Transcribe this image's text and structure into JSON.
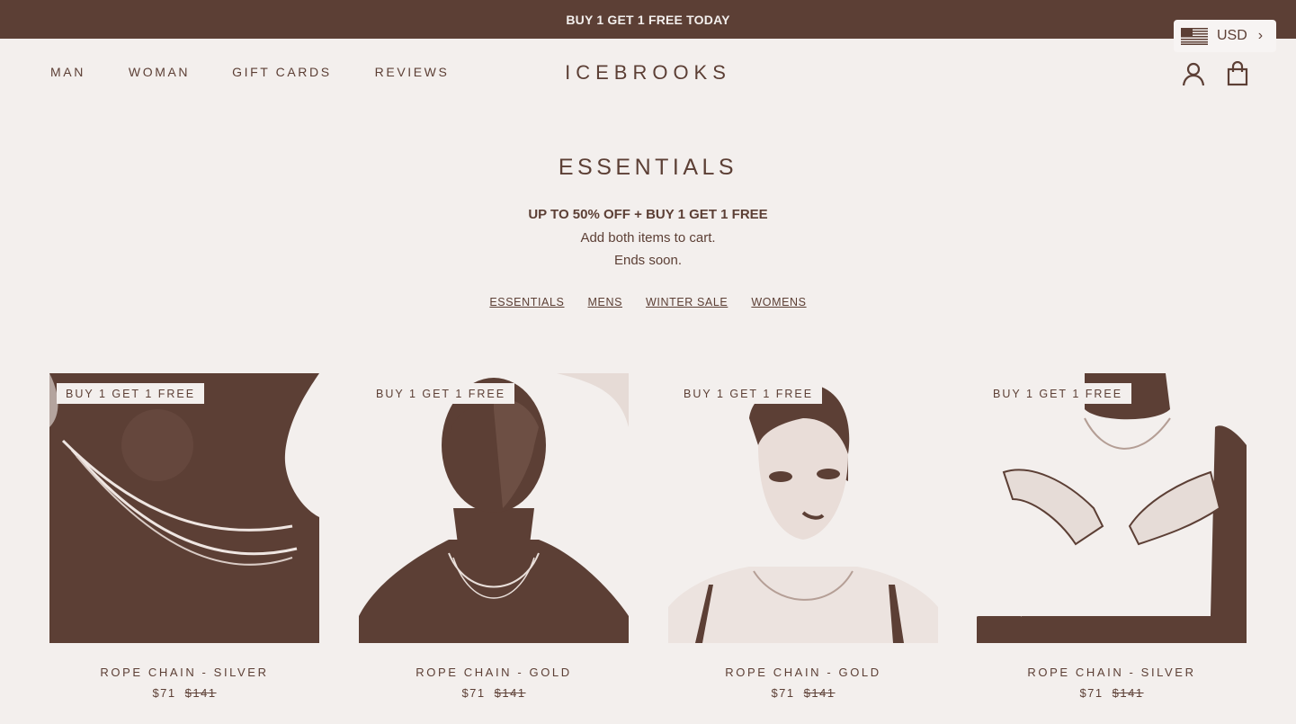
{
  "announcement": "BUY 1 GET 1 FREE TODAY",
  "currency": {
    "code": "USD"
  },
  "nav": [
    "MAN",
    "WOMAN",
    "GIFT CARDS",
    "REVIEWS"
  ],
  "brand": "ICEBROOKS",
  "collection": {
    "title": "ESSENTIALS",
    "promo": "UP TO 50% OFF + BUY 1 GET 1 FREE",
    "line1": "Add both items to cart.",
    "line2": "Ends soon."
  },
  "filters": [
    "ESSENTIALS",
    "MENS",
    "WINTER SALE",
    "WOMENS"
  ],
  "products": [
    {
      "badge": "BUY 1 GET 1 FREE",
      "title": "ROPE CHAIN - SILVER",
      "price": "$71",
      "old_price": "$141"
    },
    {
      "badge": "BUY 1 GET 1 FREE",
      "title": "ROPE CHAIN - GOLD",
      "price": "$71",
      "old_price": "$141"
    },
    {
      "badge": "BUY 1 GET 1 FREE",
      "title": "ROPE CHAIN - GOLD",
      "price": "$71",
      "old_price": "$141"
    },
    {
      "badge": "BUY 1 GET 1 FREE",
      "title": "ROPE CHAIN - SILVER",
      "price": "$71",
      "old_price": "$141"
    }
  ],
  "icons": {
    "account": "account-icon",
    "bag": "shopping-bag-icon",
    "flag": "us-flag-icon",
    "chevron": "chevron-right-icon"
  },
  "colors": {
    "brand": "#5c3f35",
    "background": "#f3efed"
  }
}
